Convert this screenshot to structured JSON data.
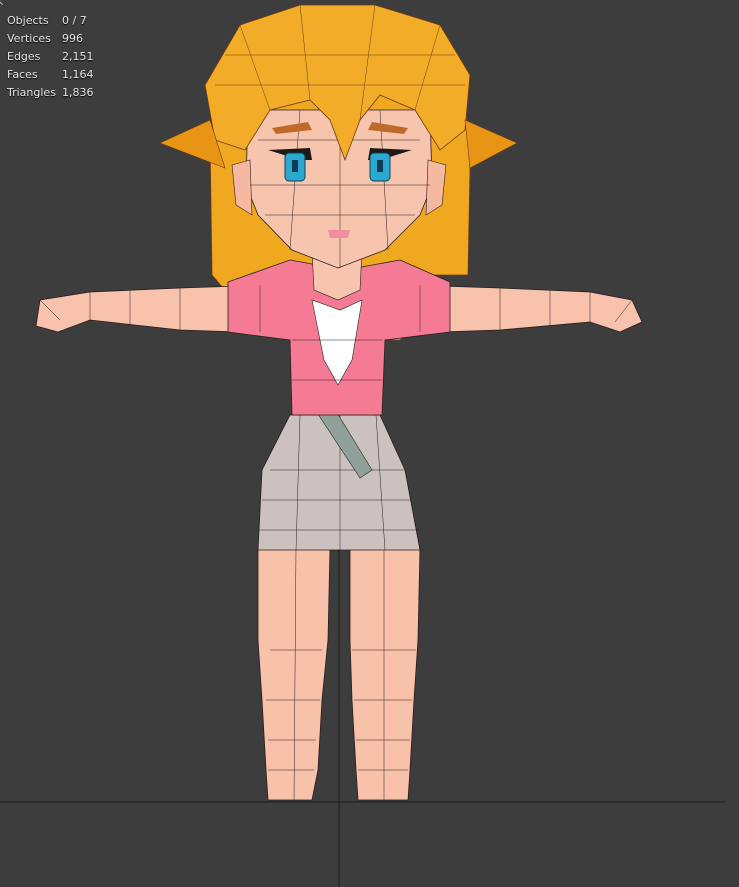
{
  "app": {
    "view": "3D Viewport"
  },
  "colors": {
    "background": "#3d3d3d",
    "hair": "#f3ac27",
    "hair_dark": "#e08f16",
    "skin": "#f7c5ae",
    "skin_shadow": "#e6a592",
    "dress_top": "#f57b94",
    "collar": "#ffffff",
    "skirt": "#cbc2bf",
    "eyes": "#2ba8cf",
    "wire": "#2a1d1d",
    "floor_line": "#1b1b1b"
  },
  "overlay": {
    "stats": [
      {
        "label": "Objects",
        "value": "0 / 7"
      },
      {
        "label": "Vertices",
        "value": "996"
      },
      {
        "label": "Edges",
        "value": "2,151"
      },
      {
        "label": "Faces",
        "value": "1,164"
      },
      {
        "label": "Triangles",
        "value": "1,836"
      }
    ]
  }
}
